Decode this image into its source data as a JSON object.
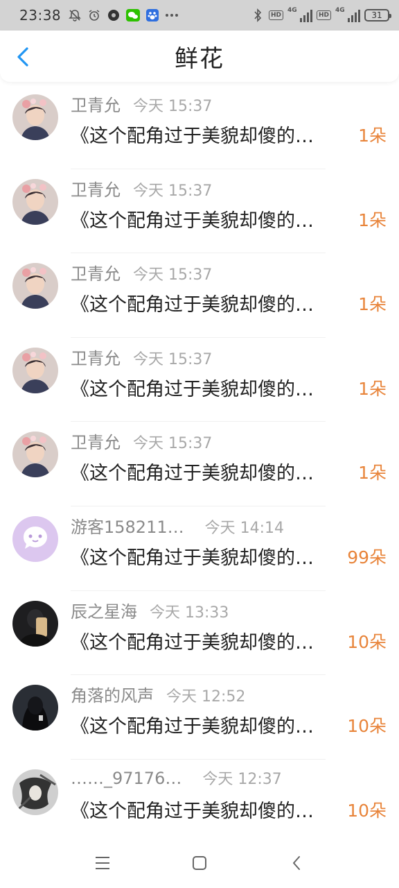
{
  "status_bar": {
    "time": "23:38",
    "battery": "31",
    "network_labels": [
      "4G",
      "4G"
    ],
    "hd_badges": [
      "HD",
      "HD"
    ]
  },
  "header": {
    "title": "鲜花"
  },
  "colors": {
    "accent": "#2196F3",
    "count": "#E8843A",
    "status_bar_bg": "#D3D3D3"
  },
  "items": [
    {
      "name": "卫青允",
      "time": "今天 15:37",
      "message": "《这个配角过于美貌却傻的…",
      "count": "1朵",
      "avatar": "portrait"
    },
    {
      "name": "卫青允",
      "time": "今天 15:37",
      "message": "《这个配角过于美貌却傻的…",
      "count": "1朵",
      "avatar": "portrait"
    },
    {
      "name": "卫青允",
      "time": "今天 15:37",
      "message": "《这个配角过于美貌却傻的…",
      "count": "1朵",
      "avatar": "portrait"
    },
    {
      "name": "卫青允",
      "time": "今天 15:37",
      "message": "《这个配角过于美貌却傻的…",
      "count": "1朵",
      "avatar": "portrait"
    },
    {
      "name": "卫青允",
      "time": "今天 15:37",
      "message": "《这个配角过于美貌却傻的…",
      "count": "1朵",
      "avatar": "portrait"
    },
    {
      "name": "游客158211…",
      "time": "今天 14:14",
      "message": "《这个配角过于美貌却傻的…",
      "count": "99朵",
      "avatar": "guest-chat"
    },
    {
      "name": "辰之星海",
      "time": "今天 13:33",
      "message": "《这个配角过于美貌却傻的…",
      "count": "10朵",
      "avatar": "dark-photo"
    },
    {
      "name": "角落的风声",
      "time": "今天 12:52",
      "message": "《这个配角过于美貌却傻的…",
      "count": "10朵",
      "avatar": "dark-hoodie"
    },
    {
      "name": "……_97176…",
      "time": "今天 12:37",
      "message": "《这个配角过于美貌却傻的…",
      "count": "10朵",
      "avatar": "ink-art"
    }
  ]
}
